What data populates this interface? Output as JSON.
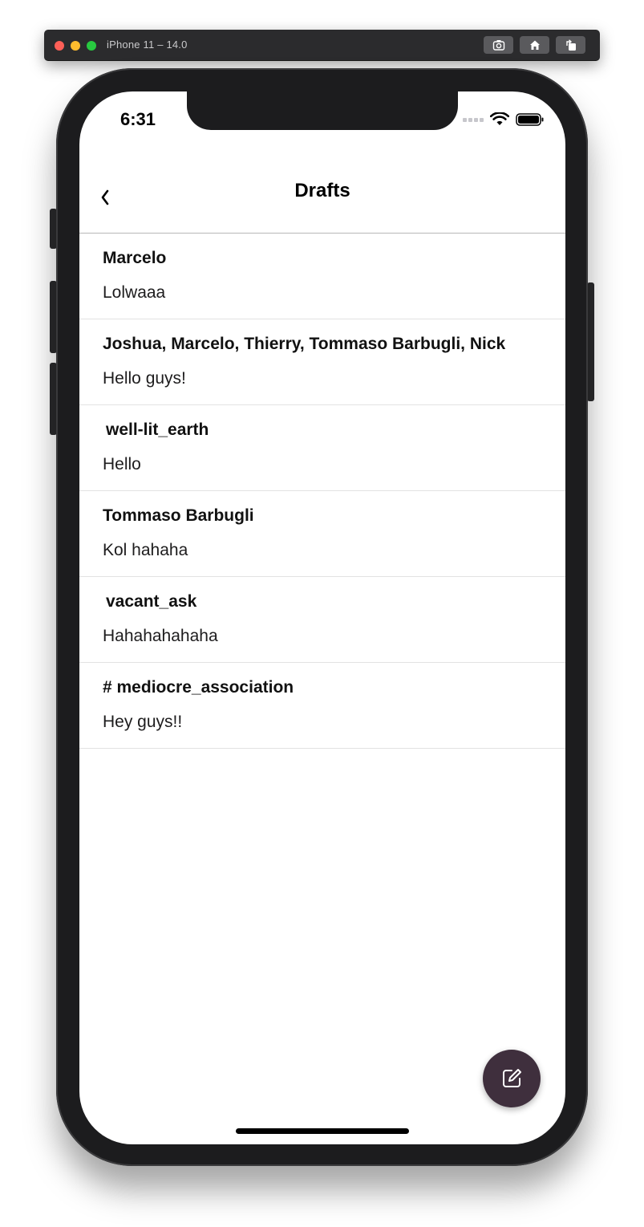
{
  "simulator": {
    "title": "iPhone 11 – 14.0",
    "buttons": [
      "screenshot-icon",
      "home-icon",
      "rotate-icon"
    ]
  },
  "status_bar": {
    "time": "6:31"
  },
  "nav": {
    "title": "Drafts",
    "back_icon": "chevron-left-icon"
  },
  "drafts": [
    {
      "title": "Marcelo",
      "text": "Lolwaaa"
    },
    {
      "title": "Joshua, Marcelo, Thierry, Tommaso Barbugli, Nick",
      "text": "Hello guys!"
    },
    {
      "title": "well-lit_earth",
      "text": "Hello"
    },
    {
      "title": "Tommaso Barbugli",
      "text": "Kol hahaha"
    },
    {
      "title": "vacant_ask",
      "text": "Hahahahahaha"
    },
    {
      "title": "# mediocre_association",
      "text": "Hey guys!!"
    }
  ],
  "fab": {
    "icon": "compose-icon",
    "color": "#3f2f3d"
  }
}
